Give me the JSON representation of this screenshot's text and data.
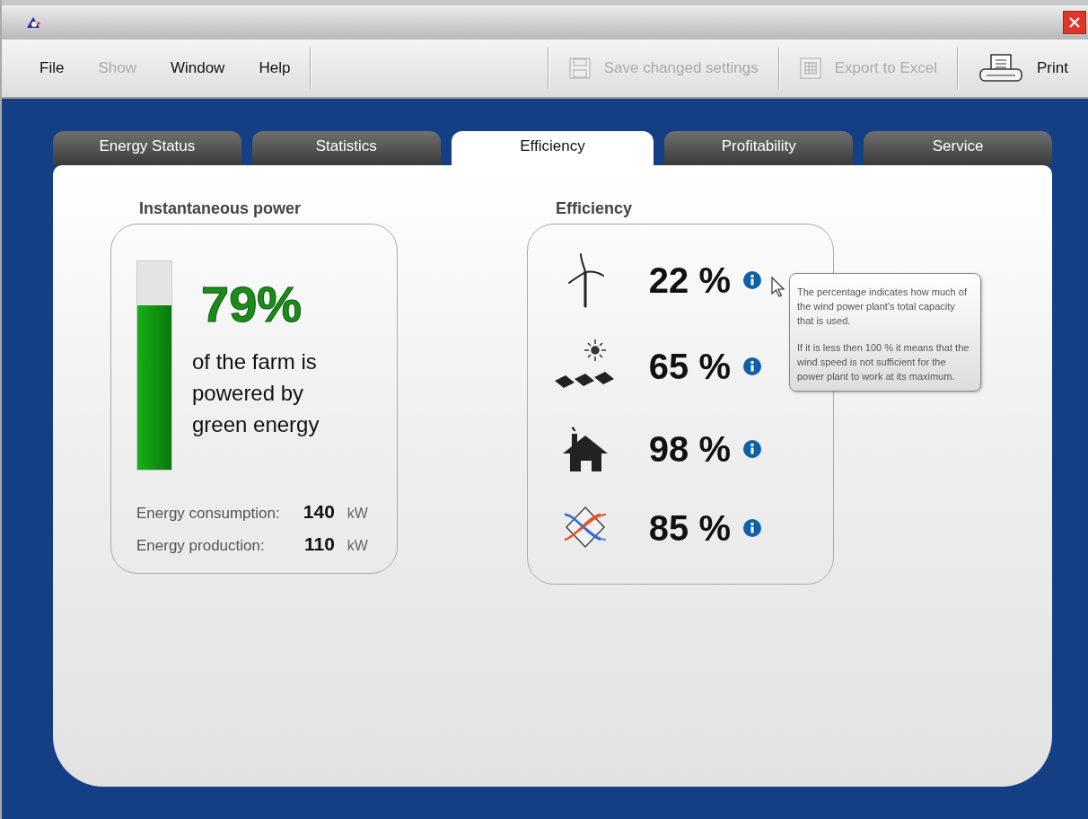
{
  "menu": [
    {
      "label": "File",
      "disabled": false
    },
    {
      "label": "Show",
      "disabled": true
    },
    {
      "label": "Window",
      "disabled": false
    },
    {
      "label": "Help",
      "disabled": false
    }
  ],
  "toolbar": [
    {
      "label": "Save changed settings",
      "kind": "save",
      "disabled": true
    },
    {
      "label": "Export to Excel",
      "kind": "excel",
      "disabled": true
    },
    {
      "label": "Print",
      "kind": "print",
      "disabled": false
    }
  ],
  "tabs": [
    {
      "label": "Energy Status",
      "selected": false
    },
    {
      "label": "Statistics",
      "selected": false
    },
    {
      "label": "Efficiency",
      "selected": true
    },
    {
      "label": "Profitability",
      "selected": false
    },
    {
      "label": "Service",
      "selected": false
    }
  ],
  "power": {
    "title": "Instantaneous power",
    "level": 0.79,
    "percent": "79%",
    "caption": "of the farm is powered by green energy",
    "readings": [
      {
        "label": "Energy consumption:",
        "value": "140",
        "unit": "kW"
      },
      {
        "label": "Energy production:",
        "value": "110",
        "unit": "kW"
      }
    ]
  },
  "efficiency": {
    "title": "Efficiency",
    "rows": [
      {
        "kind": "wind",
        "value": "22 %"
      },
      {
        "kind": "solar",
        "value": "65 %"
      },
      {
        "kind": "house",
        "value": "98 %"
      },
      {
        "kind": "exchanger",
        "value": "85 %"
      }
    ],
    "tooltip": [
      "The percentage indicates how much of the wind power plant's total capacity that is used.",
      "If it is less then 100 % it means that the wind speed is not sufficient for the power plant to work at its maximum."
    ]
  }
}
